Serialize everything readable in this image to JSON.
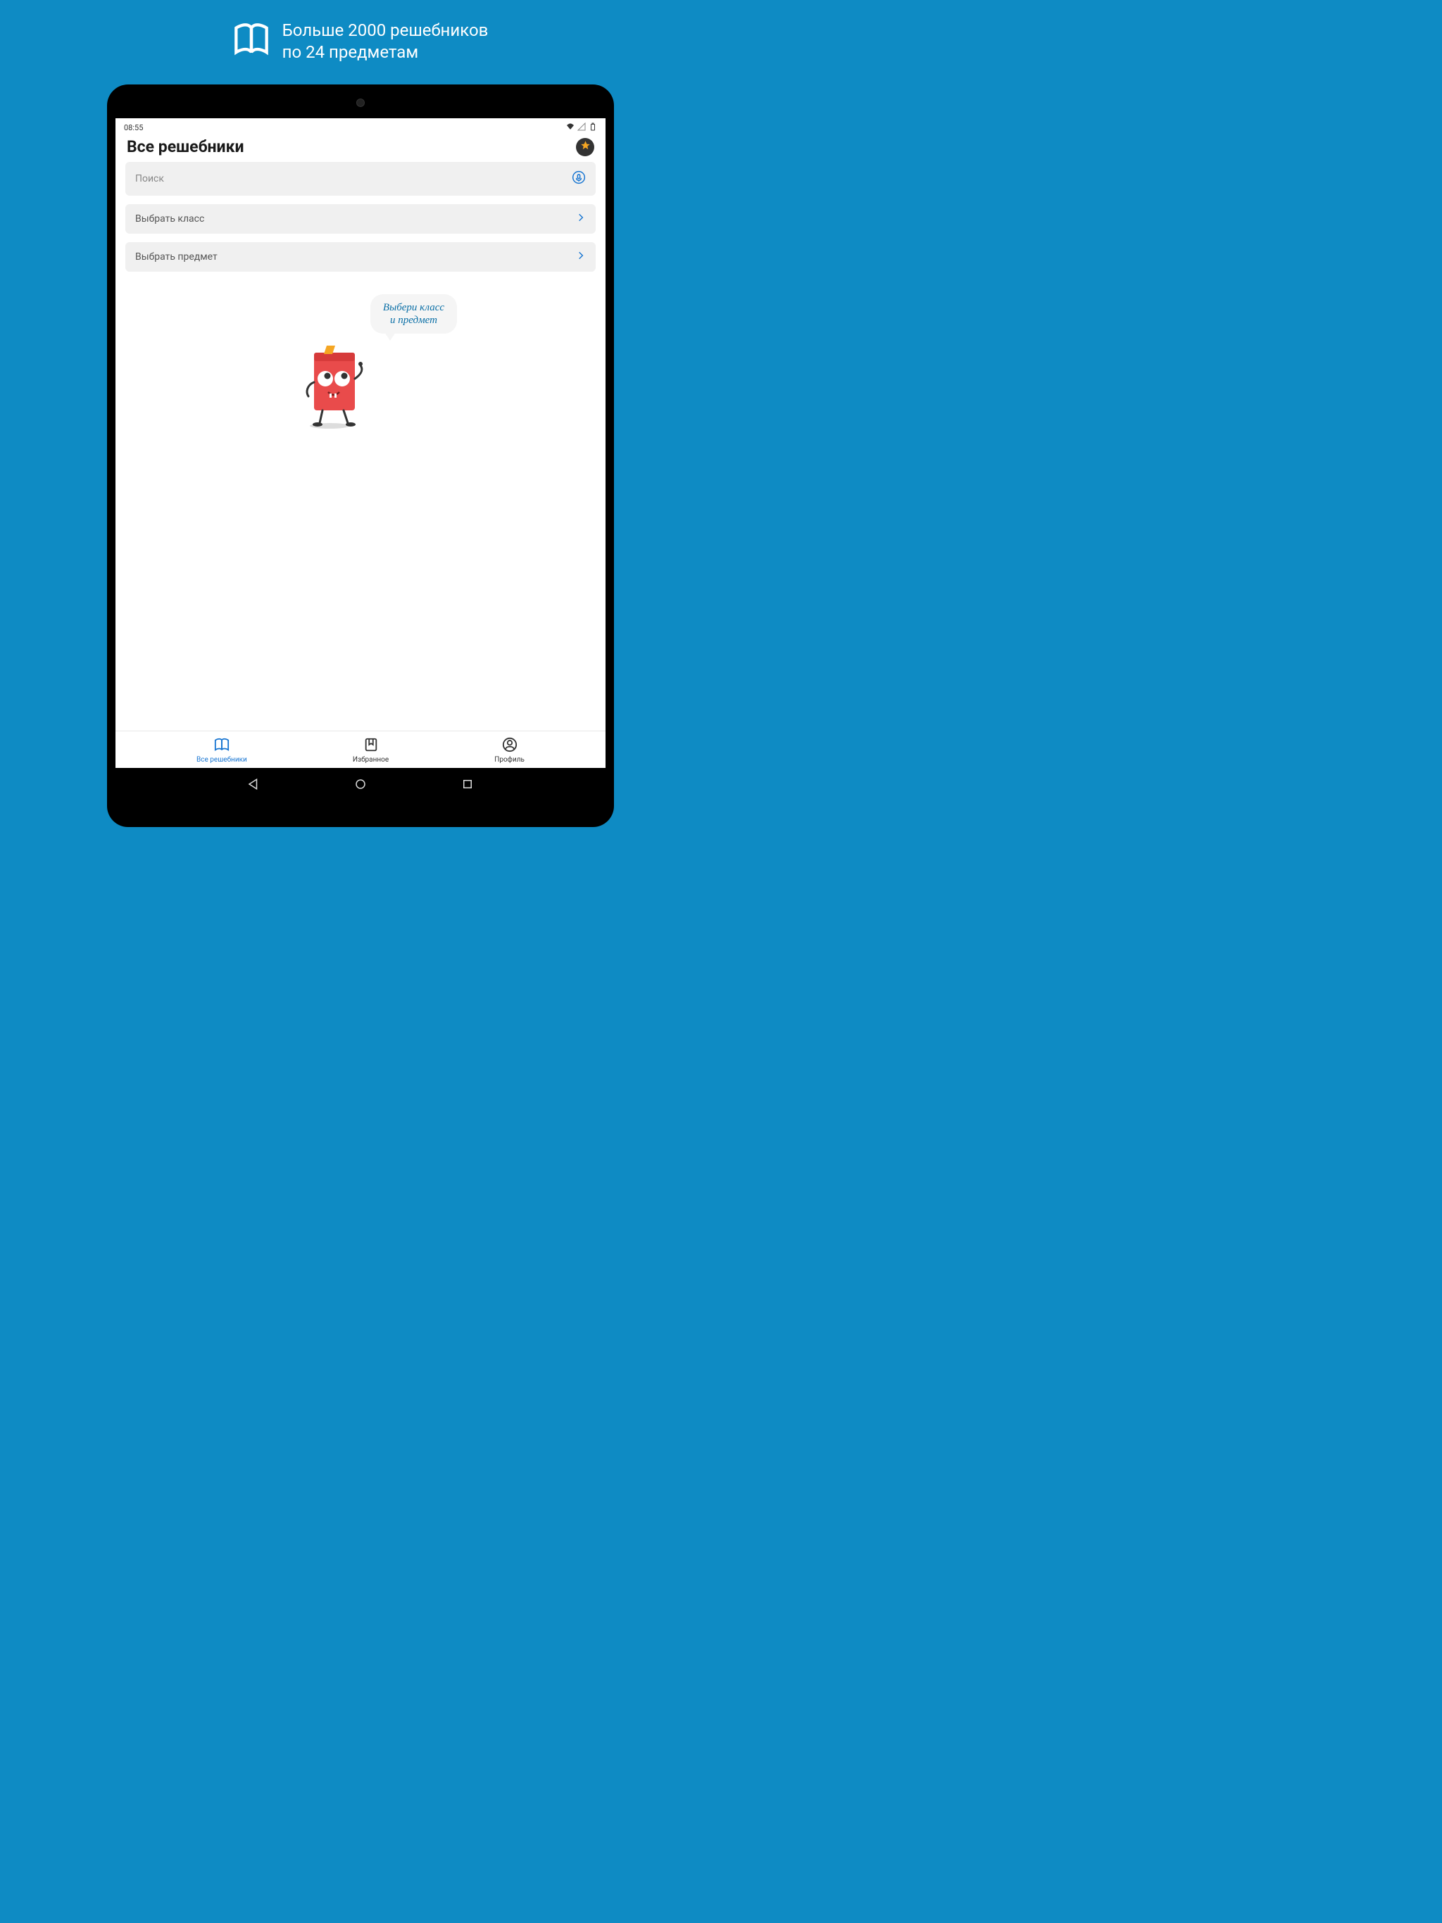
{
  "promo": {
    "line1": "Больше 2000 решебников",
    "line2": "по 24 предметам"
  },
  "status": {
    "time": "08:55"
  },
  "header": {
    "title": "Все решебники"
  },
  "search": {
    "placeholder": "Поиск"
  },
  "selectors": {
    "class_label": "Выбрать класс",
    "subject_label": "Выбрать предмет"
  },
  "mascot": {
    "bubble_line1": "Выбери класс",
    "bubble_line2": "и предмет"
  },
  "nav": {
    "all": "Все решебники",
    "fav": "Избранное",
    "profile": "Профиль"
  }
}
